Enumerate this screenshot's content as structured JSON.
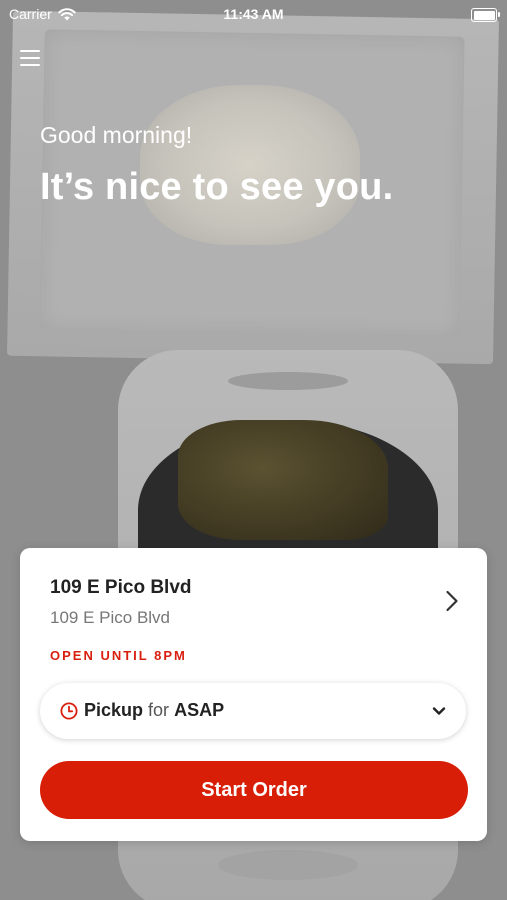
{
  "status_bar": {
    "carrier": "Carrier",
    "time": "11:43 AM",
    "wifi_icon": "wifi-icon",
    "battery_icon": "battery-icon"
  },
  "header": {
    "menu_icon": "hamburger-menu-icon",
    "greeting": "Good morning!",
    "headline": "It’s nice to see you."
  },
  "location_card": {
    "name": "109 E Pico Blvd",
    "address": "109 E Pico Blvd",
    "status": "OPEN UNTIL 8PM",
    "status_color": "#d92010",
    "chevron_icon": "chevron-right-icon",
    "order_mode": {
      "icon": "clock-icon",
      "method": "Pickup",
      "connector": "for",
      "time": "ASAP",
      "dropdown_icon": "chevron-down-icon"
    },
    "start_button_label": "Start Order",
    "start_button_color": "#d81e06"
  }
}
